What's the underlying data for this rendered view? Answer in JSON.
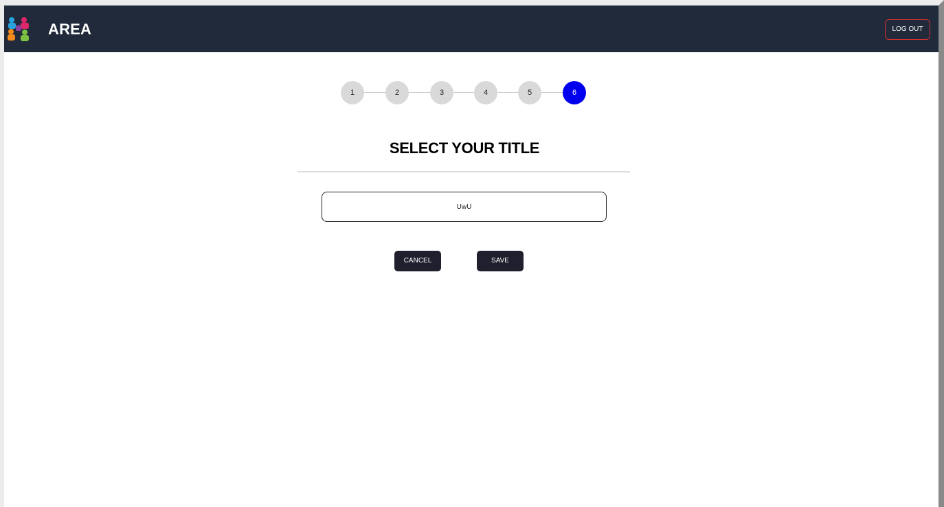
{
  "app": {
    "title": "AREA",
    "logo_icon": "puzzle-people-logo-icon"
  },
  "header": {
    "logout_label": "LOG OUT"
  },
  "stepper": {
    "steps": [
      "1",
      "2",
      "3",
      "4",
      "5",
      "6"
    ],
    "active_step": "6",
    "colors": {
      "active": "#0000ee",
      "inactive": "#d9d9d9"
    }
  },
  "form": {
    "heading": "SELECT YOUR TITLE",
    "title_value": "UwU",
    "cancel_label": "CANCEL",
    "save_label": "SAVE"
  },
  "colors": {
    "header_bg": "#212a3a",
    "logout_border": "#d32f2f",
    "button_bg": "#1f1f2e"
  }
}
